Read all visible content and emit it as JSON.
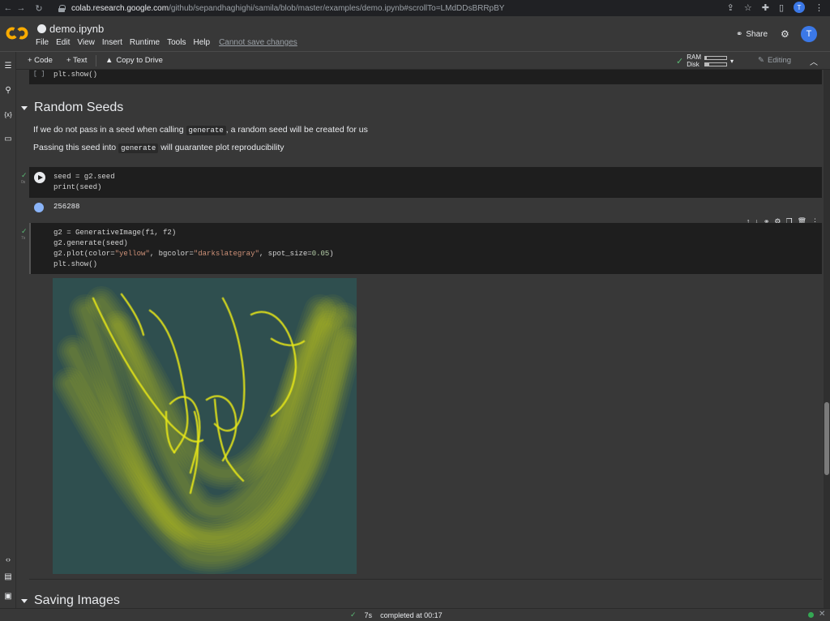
{
  "browser": {
    "url_host": "colab.research.google.com",
    "url_path": "/github/sepandhaghighi/samila/blob/master/examples/demo.ipynb#scrollTo=LMdDDsBRRpBY",
    "avatar_initial": "T"
  },
  "header": {
    "title": "demo.ipynb",
    "menu": [
      "File",
      "Edit",
      "View",
      "Insert",
      "Runtime",
      "Tools",
      "Help"
    ],
    "unsaved": "Cannot save changes",
    "share_label": "Share",
    "avatar_initial": "T"
  },
  "toolbar": {
    "add_code": "+ Code",
    "add_text": "+ Text",
    "copy_to_drive": "Copy to Drive",
    "ram_label": "RAM",
    "disk_label": "Disk",
    "ram_usage": 0.08,
    "disk_usage": 0.2,
    "editing_label": "Editing"
  },
  "cells": {
    "prev_code": "plt.show()",
    "prev_bracket": "[ ]",
    "section1_title": "Random Seeds",
    "md_line1_pre": "If we do not pass in a seed when calling ",
    "md_line1_code": "generate",
    "md_line1_post": ", a random seed will be created for us",
    "md_line2_pre": "Passing this seed into ",
    "md_line2_code": "generate",
    "md_line2_post": " will guarantee plot reproducibility",
    "seed_code": [
      "seed = g2.seed",
      "print(seed)"
    ],
    "seed_time": "0s",
    "seed_output": "256288",
    "gen_code_1": "g2 = GenerativeImage(f1, f2)",
    "gen_code_2": "g2.generate(seed)",
    "gen_code_3a": "g2.plot(color=",
    "gen_code_3b": "\"yellow\"",
    "gen_code_3c": ", bgcolor=",
    "gen_code_3d": "\"darkslategray\"",
    "gen_code_3e": ", spot_size=",
    "gen_code_3f": "0.05",
    "gen_code_3g": ")",
    "gen_code_4": "plt.show()",
    "gen_time": "7s",
    "section2_title": "Saving Images"
  },
  "plot": {
    "color": "#e6e619",
    "bgcolor": "#2f4f4f"
  },
  "status": {
    "time": "7s",
    "completed": "completed at 00:17"
  }
}
